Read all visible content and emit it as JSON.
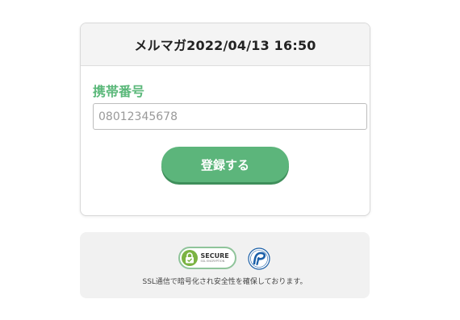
{
  "form": {
    "header_title": "メルマガ2022/04/13 16:50",
    "phone_label": "携帯番号",
    "phone_placeholder": "08012345678",
    "phone_value": "",
    "submit_label": "登録する"
  },
  "security": {
    "seal_main": "SECURE",
    "seal_sub": "SSL ENCRYPTION",
    "note": "SSL通信で暗号化され安全性を確保しております。"
  },
  "colors": {
    "accent": "#5cb57b",
    "label": "#5bb87a",
    "privacy_mark": "#1a5fa8"
  },
  "icons": {
    "seal": "lock-check-icon",
    "privacy": "privacy-mark-icon"
  }
}
